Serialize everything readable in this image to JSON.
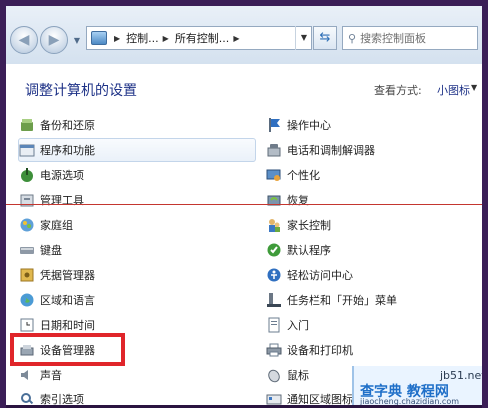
{
  "nav": {
    "address_segments": [
      "控制...",
      "所有控制...",
      ""
    ],
    "search_placeholder": "搜索控制面板"
  },
  "header": {
    "title": "调整计算机的设置",
    "view_label": "查看方式:",
    "view_value": "小图标"
  },
  "left_items": [
    {
      "label": "备份和还原",
      "icon": "backup-icon"
    },
    {
      "label": "程序和功能",
      "icon": "programs-icon"
    },
    {
      "label": "电源选项",
      "icon": "power-icon"
    },
    {
      "label": "管理工具",
      "icon": "admin-tools-icon"
    },
    {
      "label": "家庭组",
      "icon": "homegroup-icon"
    },
    {
      "label": "键盘",
      "icon": "keyboard-icon"
    },
    {
      "label": "凭据管理器",
      "icon": "credential-icon"
    },
    {
      "label": "区域和语言",
      "icon": "region-icon"
    },
    {
      "label": "日期和时间",
      "icon": "datetime-icon"
    },
    {
      "label": "设备管理器",
      "icon": "device-manager-icon"
    },
    {
      "label": "声音",
      "icon": "sound-icon"
    },
    {
      "label": "索引选项",
      "icon": "index-icon"
    }
  ],
  "right_items": [
    {
      "label": "操作中心",
      "icon": "action-center-icon"
    },
    {
      "label": "电话和调制解调器",
      "icon": "phone-modem-icon"
    },
    {
      "label": "个性化",
      "icon": "personalize-icon"
    },
    {
      "label": "恢复",
      "icon": "recovery-icon"
    },
    {
      "label": "家长控制",
      "icon": "parental-icon"
    },
    {
      "label": "默认程序",
      "icon": "default-programs-icon"
    },
    {
      "label": "轻松访问中心",
      "icon": "ease-access-icon"
    },
    {
      "label": "任务栏和「开始」菜单",
      "icon": "taskbar-icon"
    },
    {
      "label": "入门",
      "icon": "getting-started-icon"
    },
    {
      "label": "设备和打印机",
      "icon": "printer-icon"
    },
    {
      "label": "鼠标",
      "icon": "mouse-icon"
    },
    {
      "label": "通知区域图标",
      "icon": "notify-icon"
    }
  ],
  "watermark": {
    "site": "jb51.net",
    "name": "查字典 教程网",
    "url": "jiaocheng.chazidian.com"
  },
  "colors": {
    "link": "#1e3287",
    "highlight_border": "#e0252a",
    "backdrop": "#3b1e57"
  }
}
